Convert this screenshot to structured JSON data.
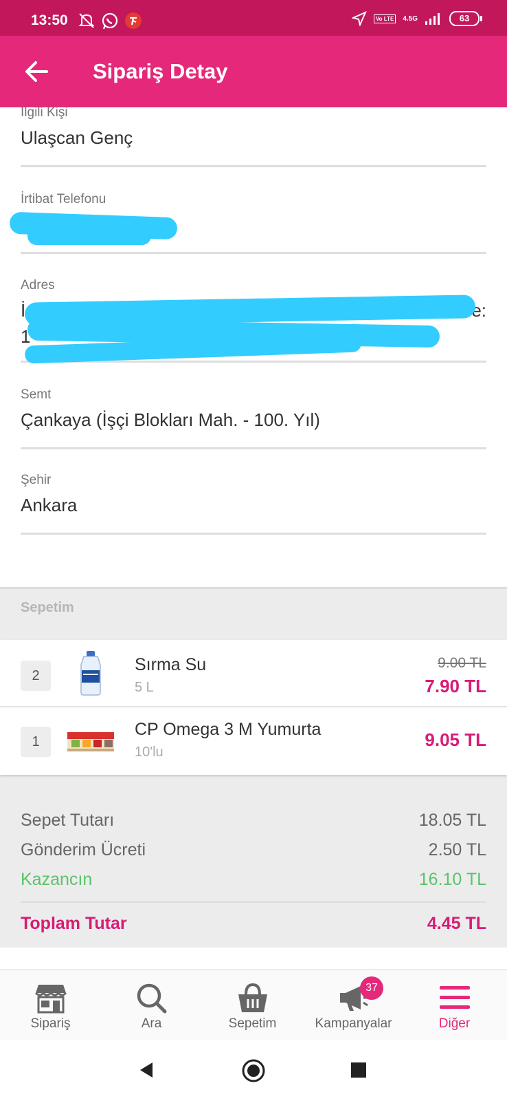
{
  "status_bar": {
    "time": "13:50",
    "network": "4.5G",
    "volte": "Vo LTE",
    "battery": "63",
    "icons": [
      "mute-icon",
      "whatsapp-icon",
      "app-notification-icon",
      "location-icon",
      "signal-icon"
    ]
  },
  "header": {
    "title": "Sipariş Detay",
    "back_icon": "arrow-left-icon"
  },
  "form": {
    "contact_label": "İlgili Kişi",
    "contact_value": "Ulaşcan Genç",
    "phone_label": "İrtibat Telefonu",
    "address_label": "Adres",
    "address_value_visible_start": "İ",
    "address_value_visible_end": "e:",
    "address_line2_visible": "1",
    "district_label": "Semt",
    "district_value": "Çankaya (İşçi Blokları Mah. - 100. Yıl)",
    "city_label": "Şehir",
    "city_value": "Ankara"
  },
  "cart": {
    "title": "Sepetim",
    "items": [
      {
        "qty": "2",
        "name": "Sırma Su",
        "unit": "5 L",
        "old_price": "9.00 TL",
        "price": "7.90 TL",
        "image": "water-bottle-image"
      },
      {
        "qty": "1",
        "name": "CP Omega 3 M Yumurta",
        "unit": "10'lu",
        "old_price": "",
        "price": "9.05 TL",
        "image": "egg-carton-image"
      }
    ]
  },
  "summary": {
    "basket_total_label": "Sepet Tutarı",
    "basket_total": "18.05 TL",
    "shipping_label": "Gönderim Ücreti",
    "shipping": "2.50 TL",
    "savings_label": "Kazancın",
    "savings": "16.10 TL",
    "total_label": "Toplam Tutar",
    "total": "4.45 TL"
  },
  "bottom_nav": [
    {
      "label": "Sipariş",
      "icon": "store-icon",
      "active": false
    },
    {
      "label": "Ara",
      "icon": "search-icon",
      "active": false
    },
    {
      "label": "Sepetim",
      "icon": "basket-icon",
      "active": false
    },
    {
      "label": "Kampanyalar",
      "icon": "megaphone-icon",
      "active": false,
      "badge": "37"
    },
    {
      "label": "Diğer",
      "icon": "menu-icon",
      "active": true
    }
  ],
  "colors": {
    "status_bar": "#c2185b",
    "app_bar": "#e5287a",
    "accent": "#d81b76",
    "savings_green": "#5cc26a",
    "redaction_scribble": "#33ccff"
  }
}
